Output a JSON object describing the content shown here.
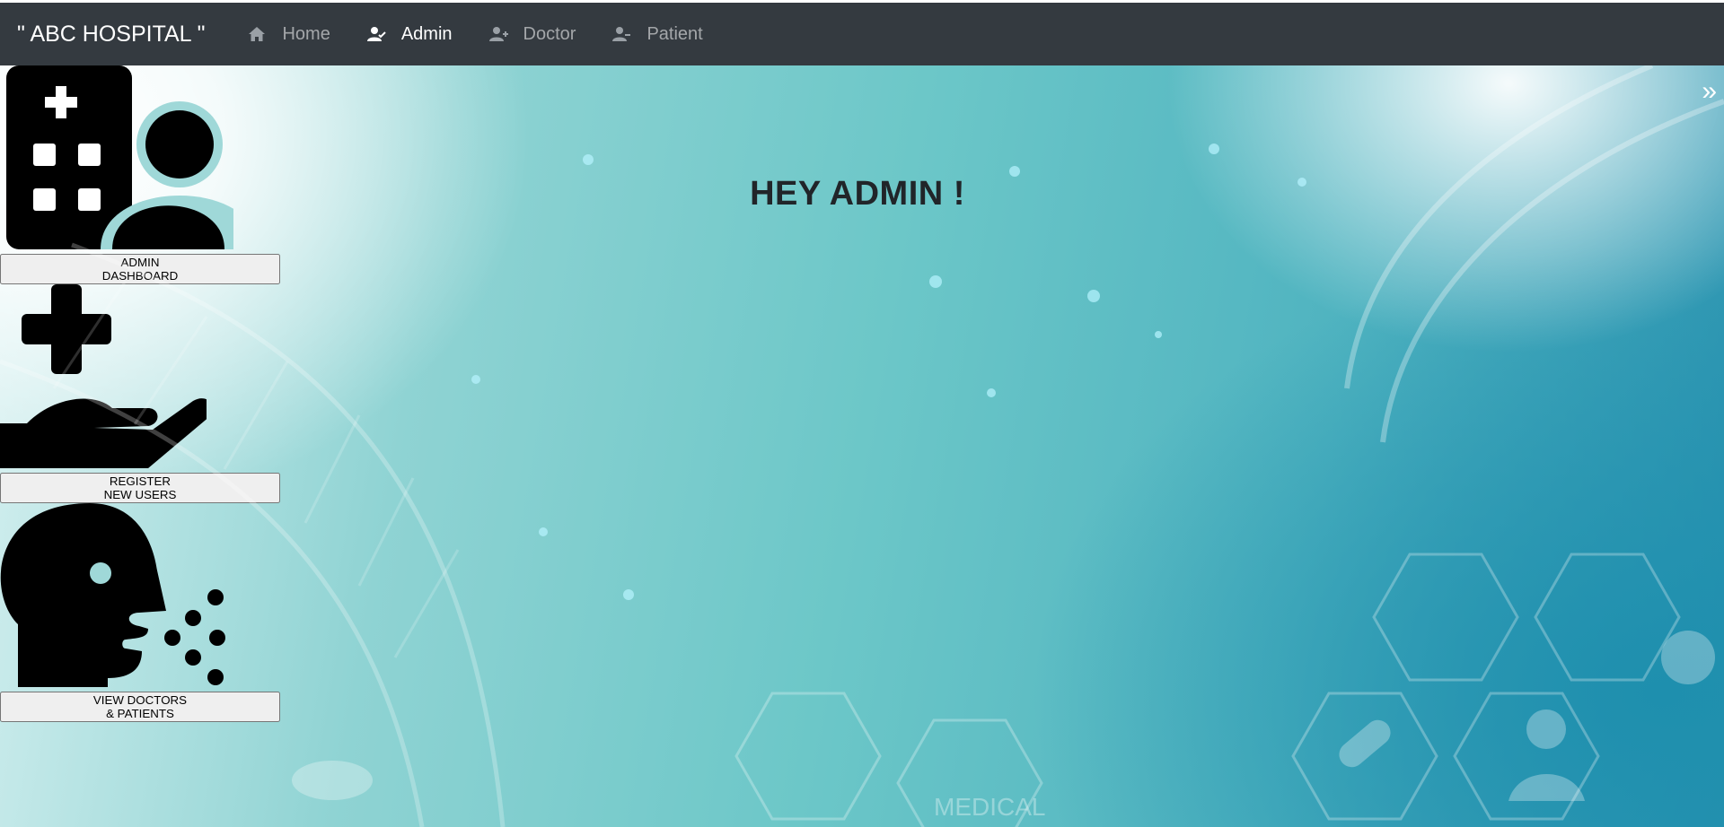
{
  "nav": {
    "brand": "\" ABC HOSPITAL \"",
    "items": [
      {
        "label": "Home",
        "icon": "home-icon",
        "active": false
      },
      {
        "label": "Admin",
        "icon": "user-check-icon",
        "active": true
      },
      {
        "label": "Doctor",
        "icon": "user-plus-icon",
        "active": false
      },
      {
        "label": "Patient",
        "icon": "user-minus-icon",
        "active": false
      }
    ]
  },
  "main": {
    "heading": "HEY ADMIN !",
    "cards": [
      {
        "icon": "hospital-user-icon",
        "button_line1": "ADMIN",
        "button_line2": "DASHBOARD",
        "chevron": "»"
      },
      {
        "icon": "hand-holding-medical-icon",
        "button_line1": "REGISTER",
        "button_line2": "NEW USERS"
      },
      {
        "icon": "head-side-cough-icon",
        "button_line1": "VIEW DOCTORS",
        "button_line2": "& PATIENTS"
      }
    ],
    "background_text": "MEDICAL"
  },
  "colors": {
    "navbar": "#343a40",
    "button": "#000000",
    "heading": "#212529"
  }
}
